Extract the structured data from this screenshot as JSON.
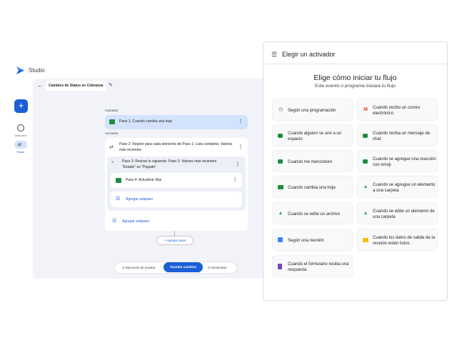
{
  "app": {
    "name": "Studio"
  },
  "sidebar": {
    "create_icon": "plus-icon",
    "items": [
      {
        "label": "Descubre",
        "icon": "compass-icon"
      },
      {
        "label": "Flows",
        "icon": "flows-icon",
        "active": true
      }
    ]
  },
  "editor": {
    "flow_title": "Cambios de Status en Cobranza",
    "trigger_label": "Activador",
    "actions_label": "Acciones",
    "step1": "Paso 1: Cuando cambia una hoja",
    "step2": "Paso 2: Repetir para cada elemento de Paso 1: Lista completa: Valores más recientes",
    "step3": "Paso 3: Revisar lo siguiente: Paso 3: Valores más recientes \"Estado\" es \"Pagado\"",
    "step4": "Paso 4: Actualizar filas",
    "add_substep_inner": "Agregar subpaso",
    "add_substep_outer": "Agregar subpaso",
    "add_step": "+ Agregar paso",
    "test_run": "Ejecución de prueba",
    "save": "Guardar cambios",
    "deactivate": "Desactivar"
  },
  "panel": {
    "title": "Elegir un activador",
    "heading": "Elige cómo iniciar tu flujo",
    "subheading": "Este evento o programa iniciará tu flujo",
    "options": [
      {
        "label": "Según una programación",
        "icon": "clock-icon"
      },
      {
        "label": "Cuando recibo un correo electrónico",
        "icon": "gmail-icon"
      },
      {
        "label": "Cuando alguien se une a un espacio",
        "icon": "chat-icon"
      },
      {
        "label": "Cuando reciba un mensaje de chat",
        "icon": "chat-icon"
      },
      {
        "label": "Cuando me mencionen",
        "icon": "chat-icon"
      },
      {
        "label": "Cuando se agregue una reacción con emoji",
        "icon": "chat-icon"
      },
      {
        "label": "Cuando cambia una hoja",
        "icon": "sheets-icon"
      },
      {
        "label": "Cuando se agregue un elemento a una carpeta",
        "icon": "drive-icon"
      },
      {
        "label": "Cuando se edite un archivo",
        "icon": "drive-icon"
      },
      {
        "label": "Cuando se edite un elemento de una carpeta",
        "icon": "drive-icon"
      },
      {
        "label": "Según una reunión",
        "icon": "calendar-icon"
      },
      {
        "label": "Cuando los datos de salida de la reunión estén listos",
        "icon": "meet-icon"
      },
      {
        "label": "Cuando el formulario reciba una respuesta",
        "icon": "forms-icon"
      }
    ]
  },
  "colors": {
    "accent": "#1a5fd6",
    "selected": "#d3e3fd",
    "canvas": "#f1f3f9",
    "sheets": "#1e8e3e"
  }
}
